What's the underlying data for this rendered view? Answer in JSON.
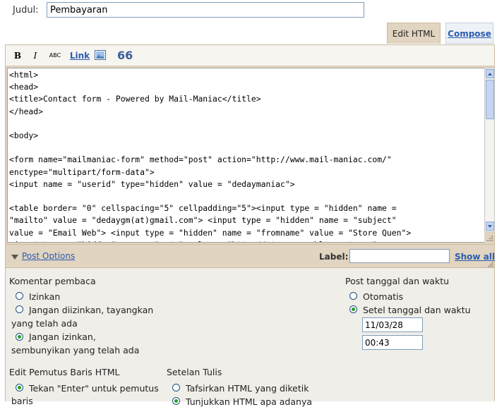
{
  "title_row": {
    "label": "Judul:",
    "value": "Pembayaran"
  },
  "tabs": {
    "edit_html": "Edit HTML",
    "compose": "Compose"
  },
  "toolbar": {
    "bold": "B",
    "italic": "I",
    "spell": "ABC",
    "link": "Link",
    "quote": "66",
    "image_icon": "image-icon"
  },
  "code": "<html>\n<head>\n<title>Contact form - Powered by Mail-Maniac</title>\n</head>\n\n<body>\n\n<form name=\"mailmaniac-form\" method=\"post\" action=\"http://www.mail-maniac.com/\"\nenctype=\"multipart/form-data\">\n<input name = \"userid\" type=\"hidden\" value = \"dedaymaniac\">\n\n<table border= \"0\" cellspacing=\"5\" cellpadding=\"5\"><input type = \"hidden\" name =\n\"mailto\" value = \"dedaygm(at)gmail.com\"> <input type = \"hidden\" name = \"subject\"\nvalue = \"Email Web\"> <input type = \"hidden\" name = \"fromname\" value = \"Store Quen\">\n<input type = \"hidden\" name = \"goto\" value = \"http://storequen.blogspot.com\">",
  "options_bar": {
    "post_options": "Post Options",
    "label_label": "Label:",
    "label_value": "",
    "show_all": "Show all"
  },
  "reader_comments": {
    "heading": "Komentar pembaca",
    "allow": "Izinkan",
    "disallow_show_line1": "Jangan diizinkan, tayangkan",
    "disallow_show_line2": "yang telah ada",
    "disallow_hide_line1": "Jangan izinkan,",
    "disallow_hide_line2": "sembunyikan yang telah ada",
    "selected": "disallow_hide"
  },
  "post_date": {
    "heading": "Post tanggal dan waktu",
    "automatic": "Otomatis",
    "set_date": "Setel tanggal dan waktu",
    "date_value": "11/03/28",
    "time_value": "00:43",
    "selected": "set_date"
  },
  "line_breaks": {
    "heading": "Edit Pemutus Baris HTML",
    "enter_line1": "Tekan \"Enter\" untuk pemutus",
    "enter_line2": "baris"
  },
  "compose_settings": {
    "heading": "Setelan Tulis",
    "interpret": "Tafsirkan HTML yang diketik",
    "show_as_is": "Tunjukkan HTML apa adanya"
  }
}
